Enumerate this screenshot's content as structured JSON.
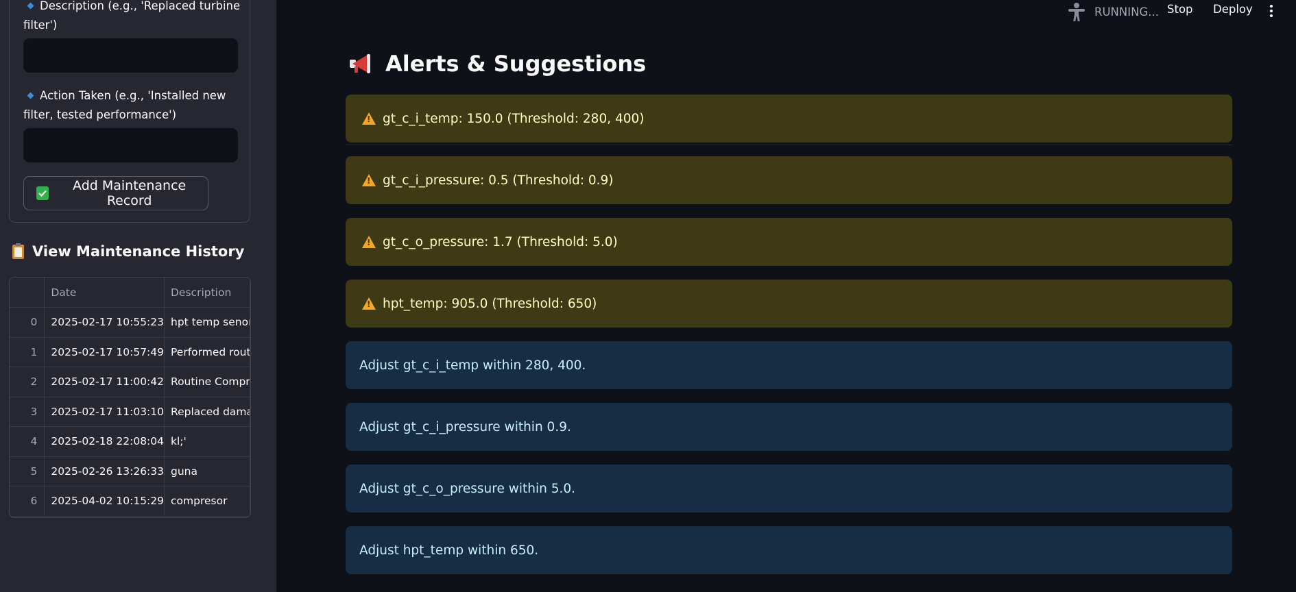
{
  "sidebar": {
    "description_label": "Description (e.g., 'Replaced turbine filter')",
    "action_label": "Action Taken (e.g., 'Installed new filter, tested performance')",
    "description_value": "",
    "action_value": "",
    "add_button_label": "Add Maintenance Record",
    "history_title": "View Maintenance History",
    "table": {
      "columns": [
        "",
        "Date",
        "Description"
      ],
      "rows": [
        {
          "index": "0",
          "date": "2025-02-17 10:55:23",
          "description": "hpt temp senor"
        },
        {
          "index": "1",
          "date": "2025-02-17 10:57:49",
          "description": "Performed rout"
        },
        {
          "index": "2",
          "date": "2025-02-17 11:00:42",
          "description": "Routine Compre"
        },
        {
          "index": "3",
          "date": "2025-02-17 11:03:10",
          "description": "Replaced dama"
        },
        {
          "index": "4",
          "date": "2025-02-18 22:08:04",
          "description": "kl;'"
        },
        {
          "index": "5",
          "date": "2025-02-26 13:26:33",
          "description": "guna"
        },
        {
          "index": "6",
          "date": "2025-04-02 10:15:29",
          "description": "compresor"
        }
      ]
    }
  },
  "topbar": {
    "status": "RUNNING...",
    "stop_label": "Stop",
    "deploy_label": "Deploy"
  },
  "main": {
    "title": "Alerts & Suggestions",
    "warnings": [
      "gt_c_i_temp: 150.0 (Threshold: 280, 400)",
      "gt_c_i_pressure: 0.5 (Threshold: 0.9)",
      "gt_c_o_pressure: 1.7 (Threshold: 5.0)",
      "hpt_temp: 905.0 (Threshold: 650)"
    ],
    "suggestions": [
      "Adjust gt_c_i_temp within 280, 400.",
      "Adjust gt_c_i_pressure within 0.9.",
      "Adjust gt_c_o_pressure within 5.0.",
      "Adjust hpt_temp within 650."
    ]
  },
  "colors": {
    "background": "#0e1117",
    "sidebar": "#262730",
    "warning_bg": "#3e3a16",
    "warning_text": "#ffffc2",
    "info_bg": "#172d43",
    "info_text": "#c7ebff",
    "success": "#2fb24a"
  },
  "icons": [
    "person-icon",
    "kebab-menu-icon",
    "megaphone-icon",
    "warning-icon",
    "clipboard-icon",
    "checkbox-icon",
    "diamond-bullet-icon"
  ]
}
